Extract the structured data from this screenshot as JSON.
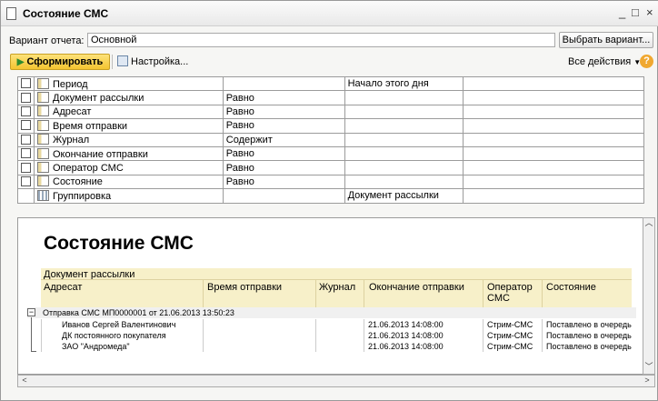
{
  "window": {
    "title": "Состояние СМС",
    "min": "_",
    "max": "□",
    "close": "×"
  },
  "variant": {
    "label": "Вариант отчета:",
    "value": "Основной",
    "choose_button": "Выбрать вариант..."
  },
  "toolbar": {
    "generate": "Сформировать",
    "settings": "Настройка...",
    "all_actions": "Все действия",
    "help": "?"
  },
  "settings_rows": [
    {
      "name": "Период",
      "condition": "",
      "value": "Начало этого дня"
    },
    {
      "name": "Документ рассылки",
      "condition": "Равно",
      "value": ""
    },
    {
      "name": "Адресат",
      "condition": "Равно",
      "value": ""
    },
    {
      "name": "Время отправки",
      "condition": "Равно",
      "value": ""
    },
    {
      "name": "Журнал",
      "condition": "Содержит",
      "value": ""
    },
    {
      "name": "Окончание отправки",
      "condition": "Равно",
      "value": ""
    },
    {
      "name": "Оператор СМС",
      "condition": "Равно",
      "value": ""
    },
    {
      "name": "Состояние",
      "condition": "Равно",
      "value": ""
    },
    {
      "name": "Группировка",
      "condition": "",
      "value": "Документ рассылки"
    }
  ],
  "report": {
    "title": "Состояние СМС",
    "group_header": "Документ рассылки",
    "columns": [
      "Адресат",
      "Время отправки",
      "Журнал",
      "Окончание отправки",
      "Оператор СМС",
      "Состояние"
    ],
    "group_row": "Отправка СМС МП0000001 от 21.06.2013 13:50:23",
    "rows": [
      {
        "addr": "Иванов Сергей Валентинович",
        "time": "",
        "journal": "",
        "end": "21.06.2013 14:08:00",
        "op": "Стрим-СМС",
        "state": "Поставлено в очередь"
      },
      {
        "addr": "ДК постоянного покупателя",
        "time": "",
        "journal": "",
        "end": "21.06.2013 14:08:00",
        "op": "Стрим-СМС",
        "state": "Поставлено в очередь"
      },
      {
        "addr": "ЗАО \"Андромеда\"",
        "time": "",
        "journal": "",
        "end": "21.06.2013 14:08:00",
        "op": "Стрим-СМС",
        "state": "Поставлено в очередь"
      }
    ]
  }
}
